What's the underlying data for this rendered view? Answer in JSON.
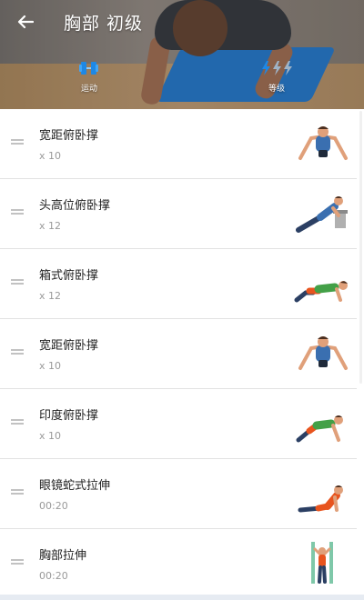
{
  "header": {
    "title": "胸部 初级",
    "back_icon": "arrow-left-icon",
    "stats": [
      {
        "label": "运动",
        "icon": "dumbbell-icon",
        "color": "#1e88e5"
      },
      {
        "label": "等级",
        "icon": "lightning-icon",
        "color": "#1e88e5"
      }
    ]
  },
  "exercises": [
    {
      "name": "宽距俯卧撑",
      "reps": "x 10",
      "icon": "wide-pushup-icon"
    },
    {
      "name": "头高位俯卧撑",
      "reps": "x 12",
      "icon": "incline-pushup-icon"
    },
    {
      "name": "箱式俯卧撑",
      "reps": "x 12",
      "icon": "knee-pushup-icon"
    },
    {
      "name": "宽距俯卧撑",
      "reps": "x 10",
      "icon": "wide-pushup-icon"
    },
    {
      "name": "印度俯卧撑",
      "reps": "x 10",
      "icon": "hindu-pushup-icon"
    },
    {
      "name": "眼镜蛇式拉伸",
      "reps": "00:20",
      "icon": "cobra-stretch-icon"
    },
    {
      "name": "胸部拉伸",
      "reps": "00:20",
      "icon": "chest-stretch-icon"
    }
  ],
  "colors": {
    "accent": "#1e88e5",
    "shirt_blue": "#3a6fb0",
    "shirt_green": "#43a047",
    "pants_orange": "#e8541e"
  }
}
